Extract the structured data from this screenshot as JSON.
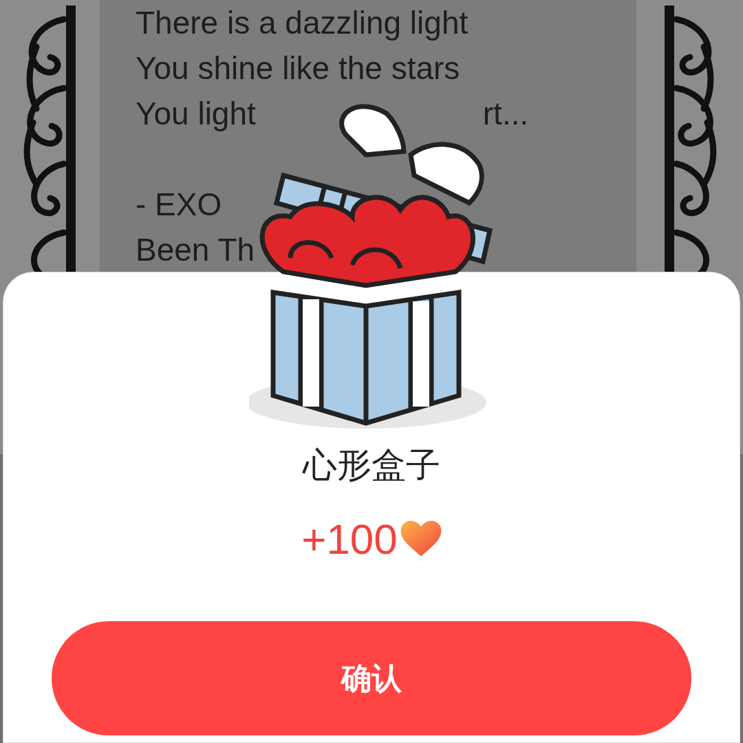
{
  "background_text": {
    "stanzas": [
      {
        "lines": [
          {
            "parts": [
              "There is a dazzling light"
            ]
          },
          {
            "parts": [
              "You shine like the stars"
            ]
          },
          {
            "parts": [
              "You light",
              "rt..."
            ]
          }
        ]
      },
      {
        "lines": [
          {
            "parts": [
              "- EXO"
            ]
          },
          {
            "parts": [
              "Been Th"
            ]
          }
        ]
      }
    ]
  },
  "reward_dialog": {
    "title": "心形盒子",
    "amount": "+100",
    "button": "确认"
  }
}
